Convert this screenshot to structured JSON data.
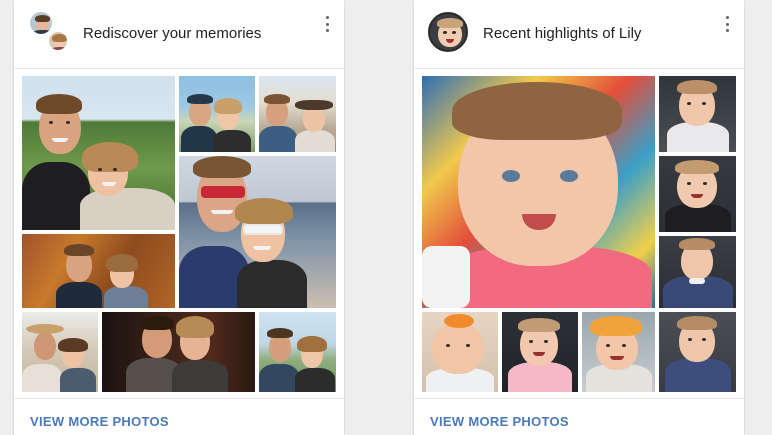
{
  "cards": [
    {
      "title": "Rediscover your memories",
      "footer_label": "VIEW MORE PHOTOS",
      "menu_icon": "more-vert-icon"
    },
    {
      "title": "Recent highlights of Lily",
      "footer_label": "VIEW MORE PHOTOS",
      "menu_icon": "more-vert-icon"
    }
  ],
  "colors": {
    "link": "#4a7ab9",
    "card_bg": "#ffffff",
    "page_bg": "#eeeeee",
    "title_text": "#222222"
  }
}
